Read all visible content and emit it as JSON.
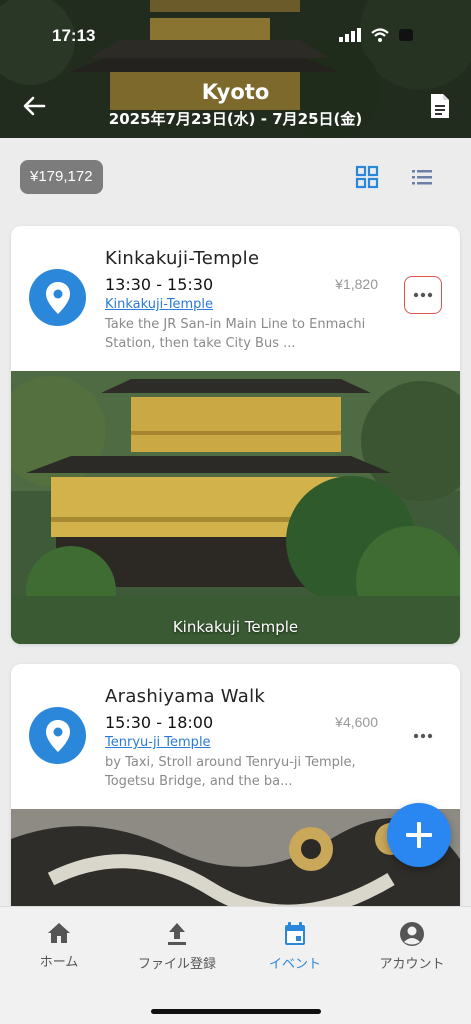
{
  "status_bar": {
    "time": "17:13"
  },
  "header": {
    "city": "Kyoto",
    "date_range": "2025年7月23日(水) - 7月25日(金)"
  },
  "summary": {
    "total_cost": "¥179,172"
  },
  "colors": {
    "accent": "#2b87d9",
    "fab": "#2a86f0",
    "highlight_border": "#e05353"
  },
  "events": [
    {
      "title": "Kinkakuji-Temple",
      "time": "13:30 - 15:30",
      "cost": "¥1,820",
      "place_link": "Kinkakuji-Temple",
      "description": "Take the JR San-in Main Line to Enmachi Station, then take City Bus ...",
      "photo_caption": "Kinkakuji Temple",
      "icon": "location-pin-icon"
    },
    {
      "title": "Arashiyama Walk",
      "time": "15:30 - 18:00",
      "cost": "¥4,600",
      "place_link": "Tenryu-ji Temple",
      "description": "by Taxi, Stroll around Tenryu-ji Temple, Togetsu Bridge, and the ba...",
      "icon": "location-pin-icon"
    }
  ],
  "bottom_nav": {
    "items": [
      {
        "label": "ホーム",
        "icon": "home-icon"
      },
      {
        "label": "ファイル登録",
        "icon": "upload-icon"
      },
      {
        "label": "イベント",
        "icon": "calendar-icon",
        "active": true
      },
      {
        "label": "アカウント",
        "icon": "account-icon"
      }
    ]
  }
}
